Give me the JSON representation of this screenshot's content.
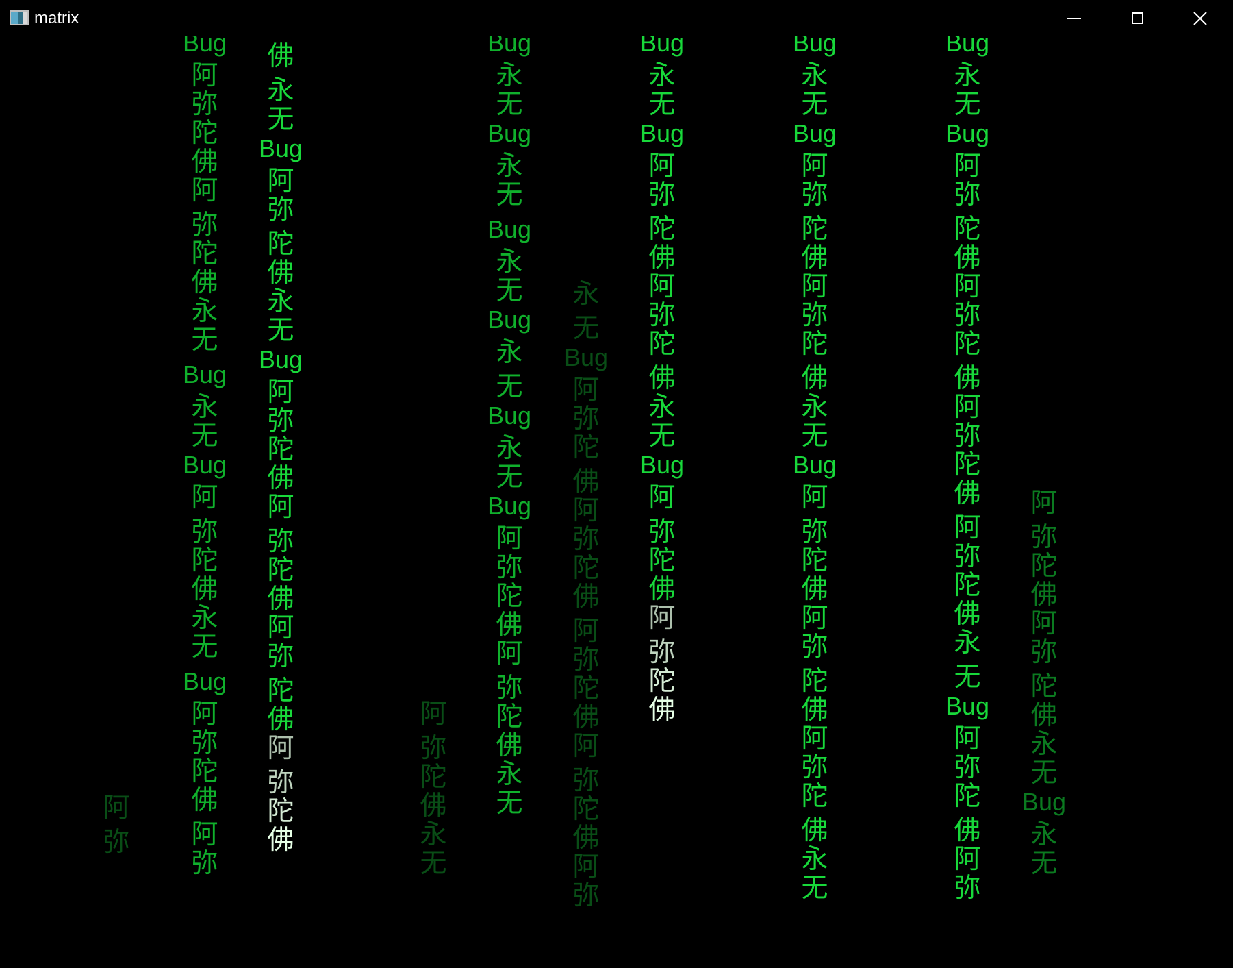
{
  "window": {
    "title": "matrix"
  },
  "icons": {
    "app": "app-window-icon",
    "minimize": "minimize-icon",
    "maximize": "maximize-icon",
    "close": "close-icon"
  },
  "colors": {
    "background": "#000000",
    "bright": "#18d83a",
    "medium": "#10b02c",
    "dim": "#0b7a20",
    "faint": "#094d16",
    "head": "#e6ffe6"
  },
  "columns": [
    {
      "name": "col-1",
      "tone": "faint",
      "chars": [
        "阿",
        "弥"
      ],
      "head": ""
    },
    {
      "name": "col-2",
      "tone": "medium",
      "chars": [
        "Bug",
        "阿",
        "弥",
        "陀",
        "佛",
        "阿",
        "弥",
        "陀",
        "佛",
        "永",
        "无",
        "Bug",
        "永",
        "无",
        "Bug",
        "阿",
        "弥",
        "陀",
        "佛",
        "永",
        "无",
        "Bug",
        "阿",
        "弥",
        "陀",
        "佛",
        "阿",
        "弥"
      ],
      "head": ""
    },
    {
      "name": "col-3",
      "tone": "bright",
      "chars": [
        "佛",
        "永",
        "无",
        "Bug",
        "阿",
        "弥",
        "陀",
        "佛",
        "永",
        "无",
        "Bug",
        "阿",
        "弥",
        "陀",
        "佛",
        "阿",
        "弥",
        "陀",
        "佛",
        "阿",
        "弥",
        "陀",
        "佛"
      ],
      "head": "阿弥陀佛"
    },
    {
      "name": "col-4",
      "tone": "faint",
      "chars": [
        "阿",
        "弥",
        "陀",
        "佛",
        "永",
        "无"
      ],
      "head": ""
    },
    {
      "name": "col-5",
      "tone": "medium",
      "chars": [
        "Bug",
        "永",
        "无",
        "Bug",
        "永",
        "无",
        "Bug",
        "永",
        "无",
        "Bug",
        "永",
        "无",
        "Bug",
        "永",
        "无",
        "Bug",
        "阿",
        "弥",
        "陀",
        "佛",
        "阿",
        "弥",
        "陀",
        "佛",
        "永",
        "无"
      ],
      "head": ""
    },
    {
      "name": "col-6",
      "tone": "faint",
      "chars": [
        "永",
        "无",
        "Bug",
        "阿",
        "弥",
        "陀",
        "佛",
        "阿",
        "弥",
        "陀",
        "佛",
        "阿",
        "弥",
        "陀",
        "佛",
        "阿",
        "弥",
        "陀",
        "佛",
        "阿",
        "弥"
      ],
      "head": ""
    },
    {
      "name": "col-7",
      "tone": "bright",
      "chars": [
        "Bug",
        "永",
        "无",
        "Bug",
        "阿",
        "弥",
        "陀",
        "佛",
        "阿",
        "弥",
        "陀",
        "佛",
        "永",
        "无",
        "Bug",
        "阿",
        "弥",
        "陀",
        "佛"
      ],
      "head": "阿弥陀佛"
    },
    {
      "name": "col-8",
      "tone": "bright",
      "chars": [
        "Bug",
        "永",
        "无",
        "Bug",
        "阿",
        "弥",
        "陀",
        "佛",
        "阿",
        "弥",
        "陀",
        "佛",
        "永",
        "无",
        "Bug",
        "阿",
        "弥",
        "陀",
        "佛",
        "阿",
        "弥",
        "陀",
        "佛",
        "阿",
        "弥",
        "陀",
        "佛",
        "永",
        "无"
      ],
      "head": ""
    },
    {
      "name": "col-9",
      "tone": "bright",
      "chars": [
        "Bug",
        "永",
        "无",
        "Bug",
        "阿",
        "弥",
        "陀",
        "佛",
        "阿",
        "弥",
        "陀",
        "佛",
        "阿",
        "弥",
        "陀",
        "佛",
        "阿",
        "弥",
        "陀",
        "佛",
        "永",
        "无",
        "Bug",
        "阿",
        "弥",
        "陀",
        "佛",
        "阿",
        "弥"
      ],
      "head": ""
    },
    {
      "name": "col-10",
      "tone": "dim",
      "chars": [
        "阿",
        "弥",
        "陀",
        "佛",
        "阿",
        "弥",
        "陀",
        "佛",
        "永",
        "无",
        "Bug",
        "永",
        "无"
      ],
      "head": ""
    }
  ]
}
